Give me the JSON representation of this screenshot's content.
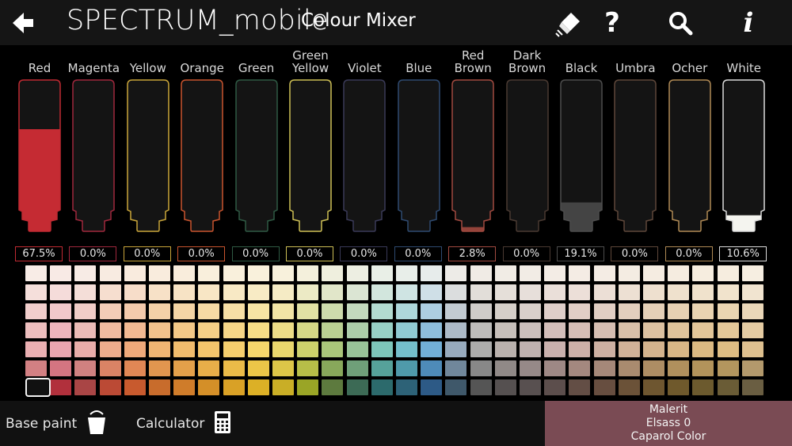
{
  "header": {
    "title": "SPECTRUM_mobile",
    "subtitle": "Colour Mixer",
    "icons": [
      "back-arrow-icon",
      "eraser-icon",
      "help-icon",
      "search-icon",
      "info-icon"
    ],
    "help_glyph": "?",
    "info_glyph": "i"
  },
  "tubes": [
    {
      "name": "Red",
      "percent": "67.5%",
      "fill": 0.675,
      "color": "#c52b33",
      "outline": "#c02a32"
    },
    {
      "name": "Magenta",
      "percent": "0.0%",
      "fill": 0,
      "color": "#b02a5a",
      "outline": "#a0283d"
    },
    {
      "name": "Yellow",
      "percent": "0.0%",
      "fill": 0,
      "color": "#e8c447",
      "outline": "#c9a53a"
    },
    {
      "name": "Orange",
      "percent": "0.0%",
      "fill": 0,
      "color": "#e06a2d",
      "outline": "#c9542e"
    },
    {
      "name": "Green",
      "percent": "0.0%",
      "fill": 0,
      "color": "#2f6a4c",
      "outline": "#2f5a44"
    },
    {
      "name": "Green\nYellow",
      "percent": "0.0%",
      "fill": 0,
      "color": "#d6d05a",
      "outline": "#cdbf55"
    },
    {
      "name": "Violet",
      "percent": "0.0%",
      "fill": 0,
      "color": "#3b3a6b",
      "outline": "#3a3a58"
    },
    {
      "name": "Blue",
      "percent": "0.0%",
      "fill": 0,
      "color": "#2a4a80",
      "outline": "#2e4a70"
    },
    {
      "name": "Red\nBrown",
      "percent": "2.8%",
      "fill": 0.028,
      "color": "#93433a",
      "outline": "#a24a40"
    },
    {
      "name": "Dark\nBrown",
      "percent": "0.0%",
      "fill": 0,
      "color": "#5a4035",
      "outline": "#4a3a32"
    },
    {
      "name": "Black",
      "percent": "19.1%",
      "fill": 0.191,
      "color": "#444444",
      "outline": "#4d4d4d"
    },
    {
      "name": "Umbra",
      "percent": "0.0%",
      "fill": 0,
      "color": "#6b4a38",
      "outline": "#5e473a"
    },
    {
      "name": "Ocher",
      "percent": "0.0%",
      "fill": 0,
      "color": "#c99650",
      "outline": "#b08a55"
    },
    {
      "name": "White",
      "percent": "10.6%",
      "fill": 0.106,
      "color": "#f4f4ef",
      "outline": "#dcdcdc"
    }
  ],
  "palette": {
    "rows": 7,
    "columns": 30,
    "hues": [
      "#e8a6aa",
      "#e79aa6",
      "#e5a2a0",
      "#eba27f",
      "#ee9f6a",
      "#eeac62",
      "#f0b45b",
      "#f3bf5a",
      "#f4c95b",
      "#f4d25a",
      "#e7d35b",
      "#c7cc5a",
      "#9fc06a",
      "#8bbc8c",
      "#6cc0b3",
      "#62b8c6",
      "#5fa6d4",
      "#8aa0b6",
      "#a3a3a3",
      "#b0a8a4",
      "#b7a8a6",
      "#c2a7a4",
      "#c7a79e",
      "#c7a798",
      "#cba98c",
      "#cfaa80",
      "#d3ad78",
      "#d7b173",
      "#dab574",
      "#dab982"
    ],
    "dark_row": [
      "#a93a3a",
      "#b1303c",
      "#a94545",
      "#bb4a35",
      "#c85a2e",
      "#c86c2c",
      "#cf7c2a",
      "#d48f28",
      "#d9a126",
      "#dcb026",
      "#c9ae26",
      "#9aa526",
      "#5d7a3e",
      "#3c6a55",
      "#2c6a6c",
      "#2d6277",
      "#2d5a86",
      "#3f586a",
      "#555555",
      "#555050",
      "#585050",
      "#5c4e4c",
      "#634e45",
      "#674e40",
      "#6b5238",
      "#6e5630",
      "#6f592c",
      "#6c5a2e",
      "#6a5c36",
      "#6a5e42"
    ]
  },
  "bottom": {
    "base_paint_label": "Base paint",
    "calculator_label": "Calculator",
    "result": {
      "line1": "Malerit",
      "line2": "Elsass 0",
      "line3": "Caparol Color",
      "color": "#7a4b54"
    }
  }
}
